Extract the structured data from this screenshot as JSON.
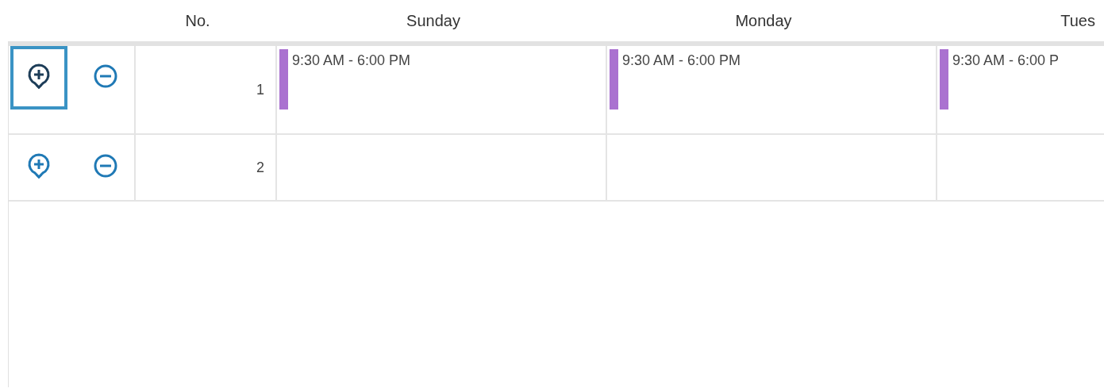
{
  "columns": [
    {
      "label": "No."
    },
    {
      "label": "Sunday"
    },
    {
      "label": "Monday"
    },
    {
      "label": "Tues"
    }
  ],
  "rows": [
    {
      "focused": true,
      "number": "1",
      "cells": [
        {
          "event": {
            "time": "9:30 AM - 6:00 PM",
            "color": "#aa72d0"
          }
        },
        {
          "event": {
            "time": "9:30 AM - 6:00 PM",
            "color": "#aa72d0"
          }
        },
        {
          "event": {
            "time": "9:30 AM - 6:00 P",
            "color": "#aa72d0"
          }
        }
      ]
    },
    {
      "focused": false,
      "number": "2",
      "cells": [
        {},
        {},
        {}
      ]
    }
  ]
}
